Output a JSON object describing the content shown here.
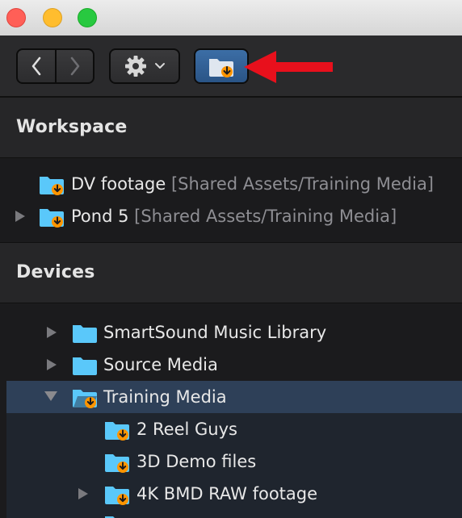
{
  "titlebar": {
    "buttons": [
      "close",
      "minimize",
      "maximize"
    ]
  },
  "toolbar": {
    "back_icon": "chevron-left-icon",
    "forward_icon": "chevron-right-icon",
    "gear_icon": "gear-icon",
    "import_icon": "folder-import-icon",
    "annotation_color": "#e8101c"
  },
  "workspace": {
    "title": "Workspace",
    "items": [
      {
        "label": "DV footage",
        "path": "[Shared Assets/Training Media]"
      },
      {
        "label": "Pond 5",
        "path": "[Shared Assets/Training Media]"
      }
    ]
  },
  "devices": {
    "title": "Devices",
    "items": [
      {
        "label": "SmartSound Music Library"
      },
      {
        "label": "Source Media"
      },
      {
        "label": "Training Media"
      },
      {
        "label": "2 Reel Guys"
      },
      {
        "label": "3D Demo files"
      },
      {
        "label": "4K BMD RAW footage"
      }
    ]
  },
  "colors": {
    "accent_blue": "#2e4058",
    "folder_blue": "#5ac8fa",
    "download_orange": "#ff9500"
  }
}
